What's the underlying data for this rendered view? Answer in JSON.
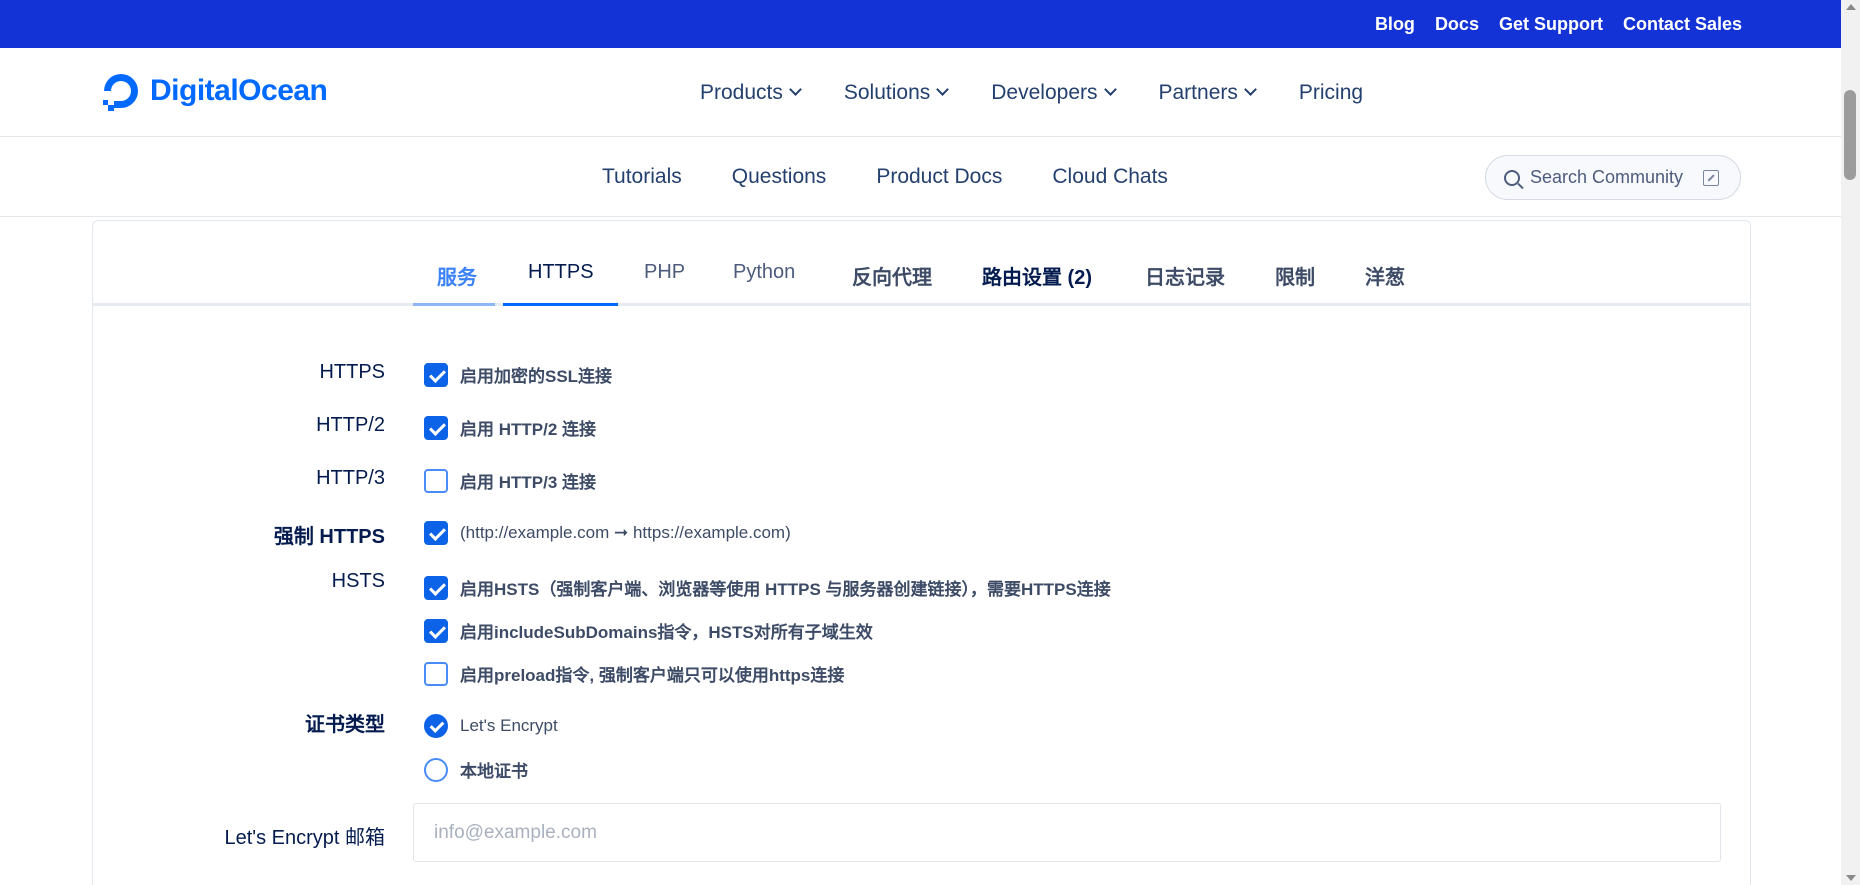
{
  "topbar": {
    "links": [
      "Blog",
      "Docs",
      "Get Support",
      "Contact Sales"
    ]
  },
  "brand": {
    "name": "DigitalOcean",
    "color": "#0069ff"
  },
  "main_nav": {
    "items": [
      {
        "label": "Products",
        "dropdown": true
      },
      {
        "label": "Solutions",
        "dropdown": true
      },
      {
        "label": "Developers",
        "dropdown": true
      },
      {
        "label": "Partners",
        "dropdown": true
      },
      {
        "label": "Pricing",
        "dropdown": false
      }
    ]
  },
  "sub_nav": {
    "items": [
      "Tutorials",
      "Questions",
      "Product Docs",
      "Cloud Chats"
    ],
    "search_placeholder": "Search Community"
  },
  "tabs": [
    {
      "label": "服务",
      "state": "visited"
    },
    {
      "label": "HTTPS",
      "state": "active"
    },
    {
      "label": "PHP",
      "state": "normal"
    },
    {
      "label": "Python",
      "state": "normal"
    },
    {
      "label": "反向代理",
      "state": "bold"
    },
    {
      "label": "路由设置 (2)",
      "state": "bold-dark"
    },
    {
      "label": "日志记录",
      "state": "bold"
    },
    {
      "label": "限制",
      "state": "bold"
    },
    {
      "label": "洋葱",
      "state": "bold"
    }
  ],
  "form": {
    "https_label": "HTTPS",
    "https_option": "启用加密的SSL连接",
    "http2_label": "HTTP/2",
    "http2_option": "启用 HTTP/2 连接",
    "http3_label": "HTTP/3",
    "http3_option": "启用 HTTP/3 连接",
    "force_label": "强制 HTTPS",
    "force_option": "(http://example.com ➞ https://example.com)",
    "hsts_label": "HSTS",
    "hsts_option": "启用HSTS（强制客户端、浏览器等使用 HTTPS 与服务器创建链接），需要HTTPS连接",
    "hsts_subdomains_option": "启用includeSubDomains指令，HSTS对所有子域生效",
    "hsts_preload_option": "启用preload指令, 强制客户端只可以使用https连接",
    "cert_label": "证书类型",
    "cert_option_letsencrypt": "Let's Encrypt",
    "cert_option_local": "本地证书",
    "email_label": "Let's Encrypt 邮箱",
    "email_placeholder": "info@example.com",
    "values": {
      "https": true,
      "http2": true,
      "http3": false,
      "force_https": true,
      "hsts": true,
      "hsts_subdomains": true,
      "hsts_preload": false,
      "cert_type": "Let's Encrypt"
    }
  },
  "colors": {
    "topbar": "#1433d6",
    "accent": "#0d63e8"
  }
}
